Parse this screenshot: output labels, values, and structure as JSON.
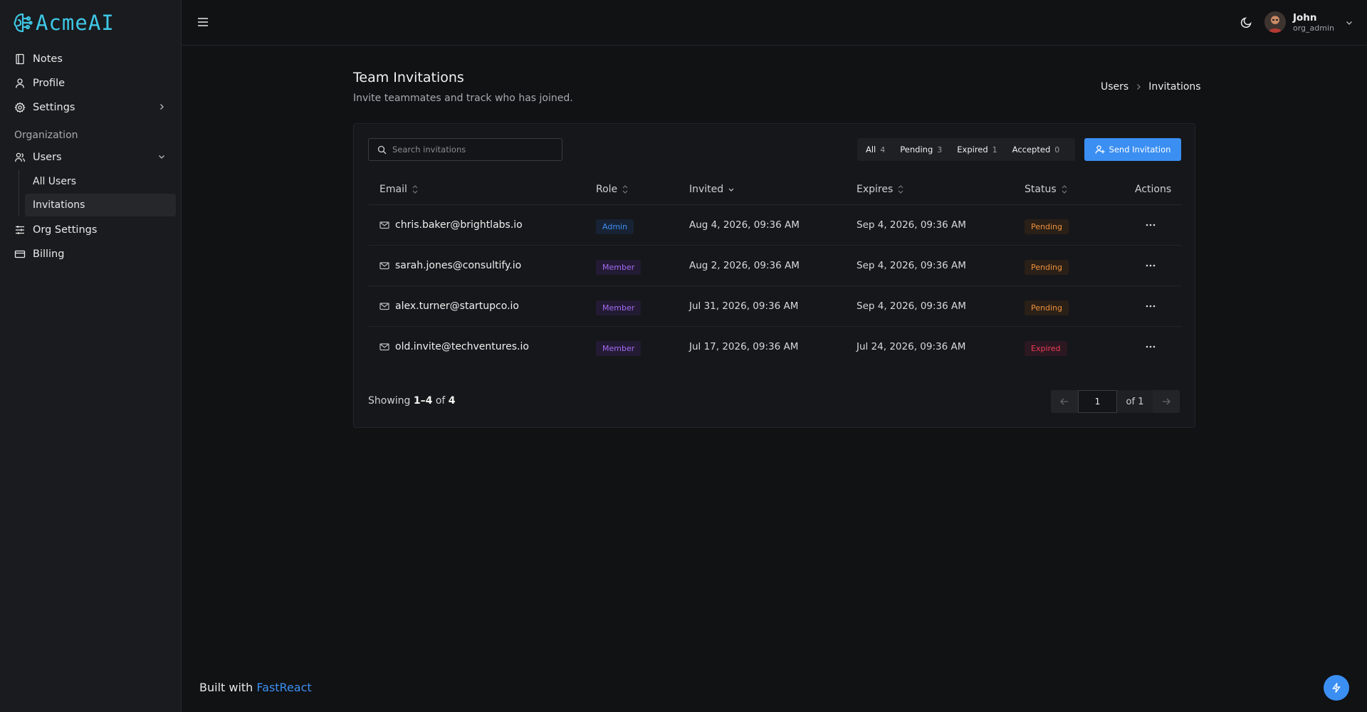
{
  "app": {
    "logo_text": "AcmeAI"
  },
  "sidebar": {
    "items": [
      {
        "label": "Notes",
        "icon": "notebook-icon"
      },
      {
        "label": "Profile",
        "icon": "user-icon"
      },
      {
        "label": "Settings",
        "icon": "gear-icon"
      }
    ],
    "section_label": "Organization",
    "users": {
      "label": "Users",
      "icon": "users-icon"
    },
    "sub_items": [
      {
        "label": "All Users",
        "active": false
      },
      {
        "label": "Invitations",
        "active": true
      }
    ],
    "bottom_items": [
      {
        "label": "Org Settings",
        "icon": "sliders-icon"
      },
      {
        "label": "Billing",
        "icon": "credit-card-icon"
      }
    ],
    "built_with_prefix": "Built with",
    "built_with_link": "FastReact"
  },
  "topbar": {
    "user_name": "John",
    "user_role": "org_admin"
  },
  "header": {
    "title": "Team Invitations",
    "subtitle": "Invite teammates and track who has joined.",
    "breadcrumb": [
      "Users",
      "Invitations"
    ]
  },
  "toolbar": {
    "search_placeholder": "Search invitations",
    "filters": [
      {
        "label": "All",
        "count": "4"
      },
      {
        "label": "Pending",
        "count": "3"
      },
      {
        "label": "Expired",
        "count": "1"
      },
      {
        "label": "Accepted",
        "count": "0"
      }
    ],
    "send_button": "Send Invitation"
  },
  "table": {
    "columns": [
      "Email",
      "Role",
      "Invited",
      "Expires",
      "Status",
      "Actions"
    ],
    "rows": [
      {
        "email": "chris.baker@brightlabs.io",
        "role": "Admin",
        "invited": "Aug 4, 2026, 09:36 AM",
        "expires": "Sep 4, 2026, 09:36 AM",
        "status": "Pending"
      },
      {
        "email": "sarah.jones@consultify.io",
        "role": "Member",
        "invited": "Aug 2, 2026, 09:36 AM",
        "expires": "Sep 4, 2026, 09:36 AM",
        "status": "Pending"
      },
      {
        "email": "alex.turner@startupco.io",
        "role": "Member",
        "invited": "Jul 31, 2026, 09:36 AM",
        "expires": "Sep 4, 2026, 09:36 AM",
        "status": "Pending"
      },
      {
        "email": "old.invite@techventures.io",
        "role": "Member",
        "invited": "Jul 17, 2026, 09:36 AM",
        "expires": "Jul 24, 2026, 09:36 AM",
        "status": "Expired"
      }
    ]
  },
  "pagination": {
    "showing_prefix": "Showing",
    "range": "1–4",
    "of_word": "of",
    "total": "4",
    "current_page": "1",
    "of_pages": "of 1"
  },
  "colors": {
    "accent": "#3b8ff2",
    "logo": "#3ec7e6",
    "pending": "#f0913a",
    "expired": "#ee3c5b",
    "admin": "#3f8ef5",
    "member": "#a46bf5"
  }
}
